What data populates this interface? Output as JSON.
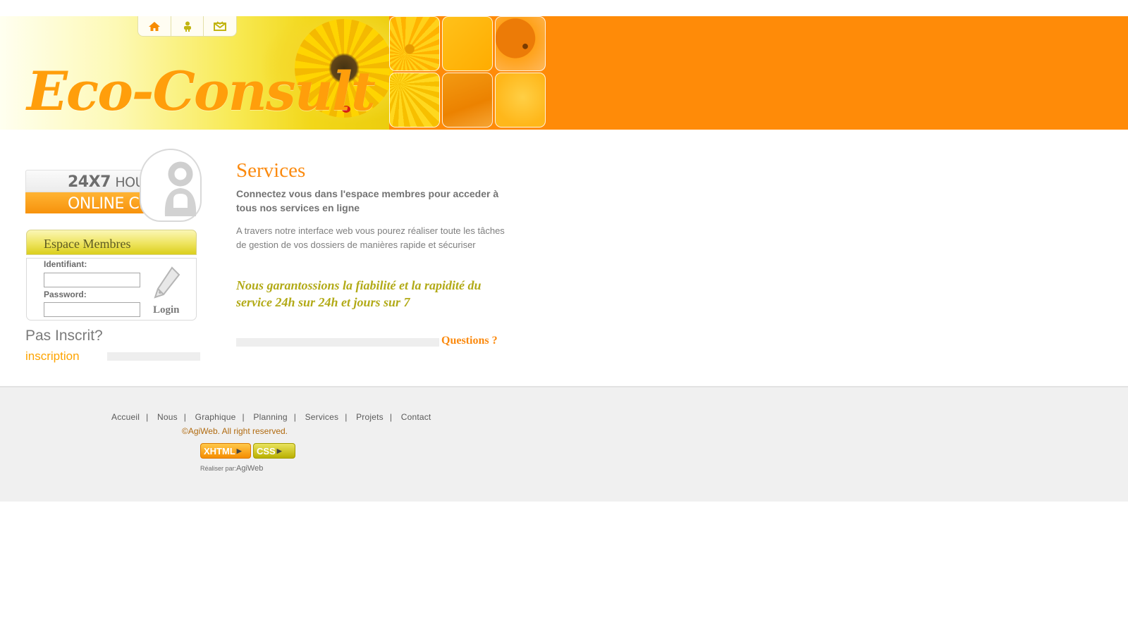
{
  "header": {
    "logo_text": "Eco-Consult",
    "nav_icons": [
      "home-icon",
      "user-icon",
      "mail-icon"
    ],
    "colors": {
      "orange_band": "#ff8b08",
      "logo_orange": "#ff9e0b",
      "nav_icon_orange": "#f78b00",
      "nav_icon_olive": "#c2b512"
    }
  },
  "sidebar": {
    "chat": {
      "hours_number": "24X7",
      "hours_word": "HOURS",
      "chat_label": "ONLINE CHAT"
    },
    "members": {
      "title": "Espace Membres",
      "username_label": "Identifiant:",
      "username_value": "",
      "password_label": "Password:",
      "password_value": "",
      "login_label": "Login"
    },
    "register": {
      "question": "Pas Inscrit?",
      "link": "inscription"
    }
  },
  "main": {
    "title": "Services",
    "lead": "Connectez vous dans l'espace membres pour acceder à tous nos services en ligne",
    "body": "A travers notre interface web vous pourez réaliser toute les tâches de gestion de vos dossiers de manières rapide et sécuriser",
    "tagline": "Nous garantossions la fiabilité et la rapidité du service 24h sur 24h et jours sur 7",
    "questions_link": "Questions ?"
  },
  "footer": {
    "nav": [
      "Accueil",
      "Nous",
      "Graphique",
      "Planning",
      "Services",
      "Projets",
      "Contact"
    ],
    "separator": "|",
    "copyright": "©AgiWeb. All right reserved.",
    "badges": {
      "xhtml": "XHTML",
      "css": "CSS"
    },
    "made_by_prefix": "Réaliser par:",
    "made_by_name": "AgiWeb"
  }
}
